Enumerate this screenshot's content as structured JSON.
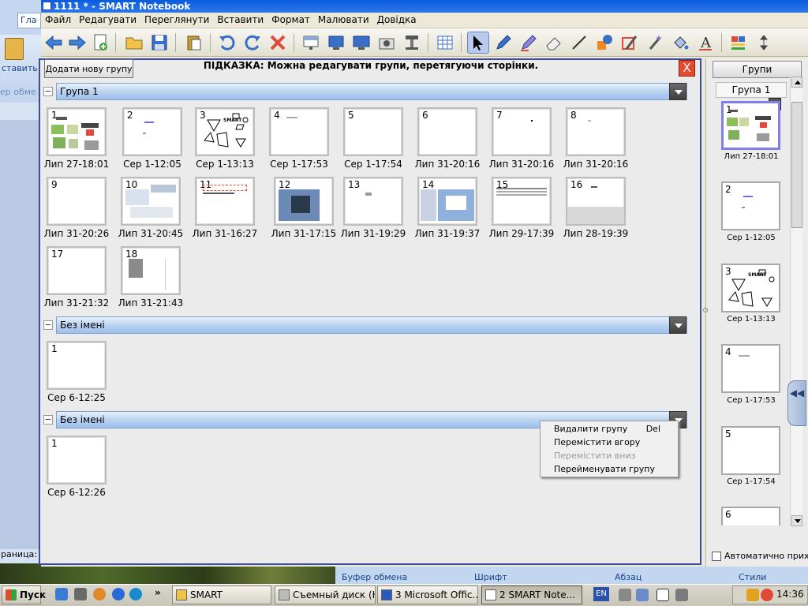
{
  "app": {
    "title": "1111 * - SMART Notebook",
    "menu": [
      "Файл",
      "Редагувати",
      "Переглянути",
      "Вставити",
      "Формат",
      "Малювати",
      "Довідка"
    ]
  },
  "background_word": {
    "tab": "Гла",
    "paste_label": "ставить",
    "buffer_label": "ер обме",
    "status": "раница: 1",
    "ribbon_groups": [
      "Буфер обмена",
      "Шрифт",
      "Абзац",
      "Стили"
    ]
  },
  "toolbar_icons": [
    "arrow-left-icon",
    "arrow-right-icon",
    "add-page-icon",
    "open-folder-icon",
    "save-icon",
    "paste-icon",
    "undo-icon",
    "redo-icon",
    "delete-icon",
    "screen-shade-icon",
    "display-icon",
    "full-screen-icon",
    "capture-icon",
    "document-camera-icon",
    "table-icon",
    "select-arrow-icon",
    "pen-icon",
    "creative-pen-icon",
    "eraser-icon",
    "line-icon",
    "shapes-icon",
    "magic-pen-icon",
    "sparkle-pen-icon",
    "fill-icon",
    "text-icon",
    "properties-icon",
    "move-toolbar-icon"
  ],
  "sorter": {
    "add_group_label": "Додати нову групу",
    "hint": "ПІДКАЗКА: Можна редагувати групи, перетягуючи сторінки.",
    "close_label": "X",
    "groups": [
      {
        "name": "Група 1",
        "pages": [
          {
            "num": "1",
            "label": "Лип 27-18:01"
          },
          {
            "num": "2",
            "label": "Сер 1-12:05"
          },
          {
            "num": "3",
            "label": "Сер 1-13:13"
          },
          {
            "num": "4",
            "label": "Сер 1-17:53"
          },
          {
            "num": "5",
            "label": "Сер 1-17:54"
          },
          {
            "num": "6",
            "label": "Лип 31-20:16"
          },
          {
            "num": "7",
            "label": "Лип 31-20:16"
          },
          {
            "num": "8",
            "label": "Лип 31-20:16"
          },
          {
            "num": "9",
            "label": "Лип 31-20:26"
          },
          {
            "num": "10",
            "label": "Лип 31-20:45"
          },
          {
            "num": "11",
            "label": "Лип 31-16:27"
          },
          {
            "num": "12",
            "label": "Лип 31-17:15"
          },
          {
            "num": "13",
            "label": "Лип 31-19:29"
          },
          {
            "num": "14",
            "label": "Лип 31-19:37"
          },
          {
            "num": "15",
            "label": "Лип 29-17:39"
          },
          {
            "num": "16",
            "label": "Лип 28-19:39"
          },
          {
            "num": "17",
            "label": "Лип 31-21:32"
          },
          {
            "num": "18",
            "label": "Лип 31-21:43"
          }
        ]
      },
      {
        "name": "Без імені",
        "pages": [
          {
            "num": "1",
            "label": "Сер 6-12:25"
          }
        ]
      },
      {
        "name": "Без імені",
        "pages": [
          {
            "num": "1",
            "label": "Сер 6-12:26"
          }
        ]
      }
    ]
  },
  "context_menu": {
    "items": [
      {
        "label": "Видалити групу",
        "shortcut": "Del",
        "enabled": true
      },
      {
        "label": "Перемістити вгору",
        "shortcut": "",
        "enabled": true
      },
      {
        "label": "Перемістити вниз",
        "shortcut": "",
        "enabled": false
      },
      {
        "label": "Перейменувати групу",
        "shortcut": "",
        "enabled": true
      }
    ]
  },
  "right_panel": {
    "groups_button": "Групи",
    "current_group": "Група 1",
    "pages": [
      {
        "num": "1",
        "label": "Лип 27-18:01"
      },
      {
        "num": "2",
        "label": "Сер 1-12:05"
      },
      {
        "num": "3",
        "label": "Сер 1-13:13"
      },
      {
        "num": "4",
        "label": "Сер 1-17:53"
      },
      {
        "num": "5",
        "label": "Сер 1-17:54"
      },
      {
        "num": "6",
        "label": ""
      }
    ],
    "auto_hide_label": "Автоматично прих",
    "collapse_glyph": "◀◀"
  },
  "taskbar": {
    "start": "Пуск",
    "tasks": [
      "SMART",
      "Съемный диск (H:)",
      "3 Microsoft Offic...",
      "2 SMART Note..."
    ],
    "lang": "EN",
    "clock": "14:36",
    "chevron": "»"
  }
}
